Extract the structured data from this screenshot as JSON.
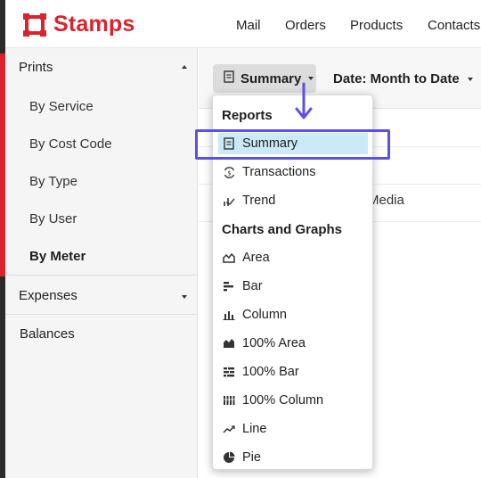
{
  "brand": {
    "name": "Stamps",
    "color": "#d9232d"
  },
  "nav": [
    "Mail",
    "Orders",
    "Products",
    "Contacts"
  ],
  "sidebar": {
    "prints": {
      "label": "Prints",
      "icon": "caret-up-icon"
    },
    "items": [
      {
        "label": "By Service"
      },
      {
        "label": "By Cost Code"
      },
      {
        "label": "By Type"
      },
      {
        "label": "By User"
      },
      {
        "label": "By Meter",
        "active": true
      }
    ],
    "expenses": {
      "label": "Expenses",
      "icon": "caret-down-icon"
    },
    "balances": {
      "label": "Balances"
    }
  },
  "toolbar": {
    "summary_label": "Summary",
    "date_label": "Date: Month to Date"
  },
  "main": {
    "background_text": "Media"
  },
  "dropdown": {
    "reports_heading": "Reports",
    "reports": [
      {
        "label": "Summary",
        "icon": "receipt-icon",
        "selected": true
      },
      {
        "label": "Transactions",
        "icon": "dollar-cycle-icon"
      },
      {
        "label": "Trend",
        "icon": "trend-icon"
      }
    ],
    "charts_heading": "Charts and Graphs",
    "charts": [
      {
        "label": "Area",
        "icon": "area-chart-icon"
      },
      {
        "label": "Bar",
        "icon": "bar-chart-icon"
      },
      {
        "label": "Column",
        "icon": "column-chart-icon"
      },
      {
        "label": "100% Area",
        "icon": "stacked-area-icon"
      },
      {
        "label": "100% Bar",
        "icon": "stacked-bar-icon"
      },
      {
        "label": "100% Column",
        "icon": "stacked-column-icon"
      },
      {
        "label": "Line",
        "icon": "line-chart-icon"
      },
      {
        "label": "Pie",
        "icon": "pie-chart-icon"
      }
    ]
  },
  "colors": {
    "highlight": "#5b50e8",
    "selected_bg": "#cbe9f6"
  }
}
